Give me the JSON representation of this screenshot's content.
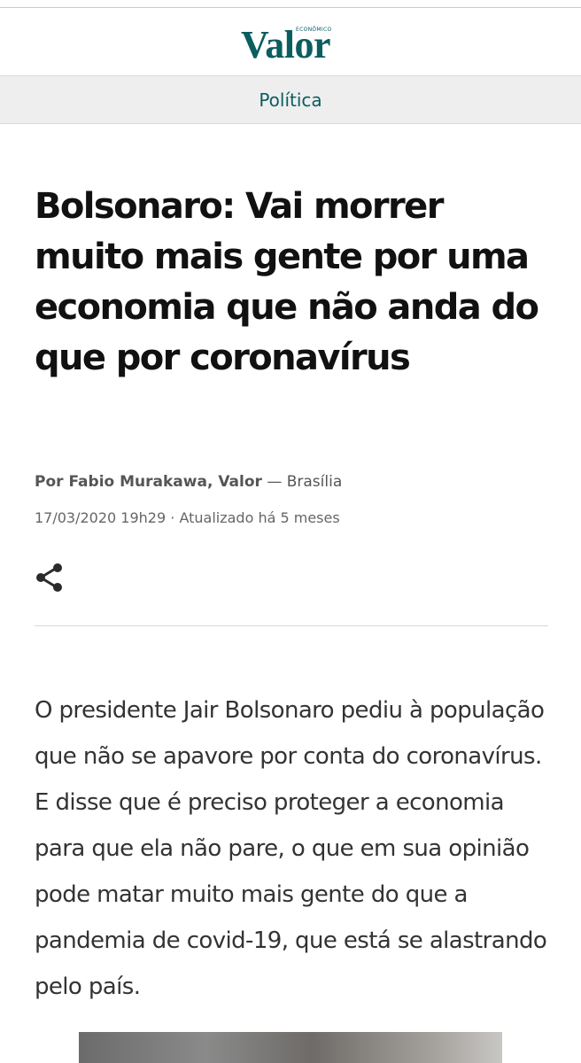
{
  "header": {
    "logo_small": "ECONÔMICO",
    "logo_main": "Valor"
  },
  "section": {
    "label": "Política"
  },
  "article": {
    "headline": "Bolsonaro: Vai morrer muito mais gente por uma economia que não anda do que por coronavírus",
    "byline_author": "Por Fabio Murakawa, Valor",
    "byline_separator": " — ",
    "byline_location": "Brasília",
    "date": "17/03/2020 19h29",
    "date_separator": " · ",
    "updated": "Atualizado há 5 meses",
    "share_icon": "share-icon",
    "body": "O presidente Jair Bolsonaro pediu à população que não se apavore por conta do coronavírus. E disse que é preciso proteger a economia para que ela não pare, o que em sua opinião pode matar muito mais gente do que a pandemia de covid-19, que está se alastrando pelo país."
  },
  "colors": {
    "brand": "#0b5d5f",
    "headline": "#111111",
    "body": "#333333",
    "section_bg": "#eeeeee"
  }
}
